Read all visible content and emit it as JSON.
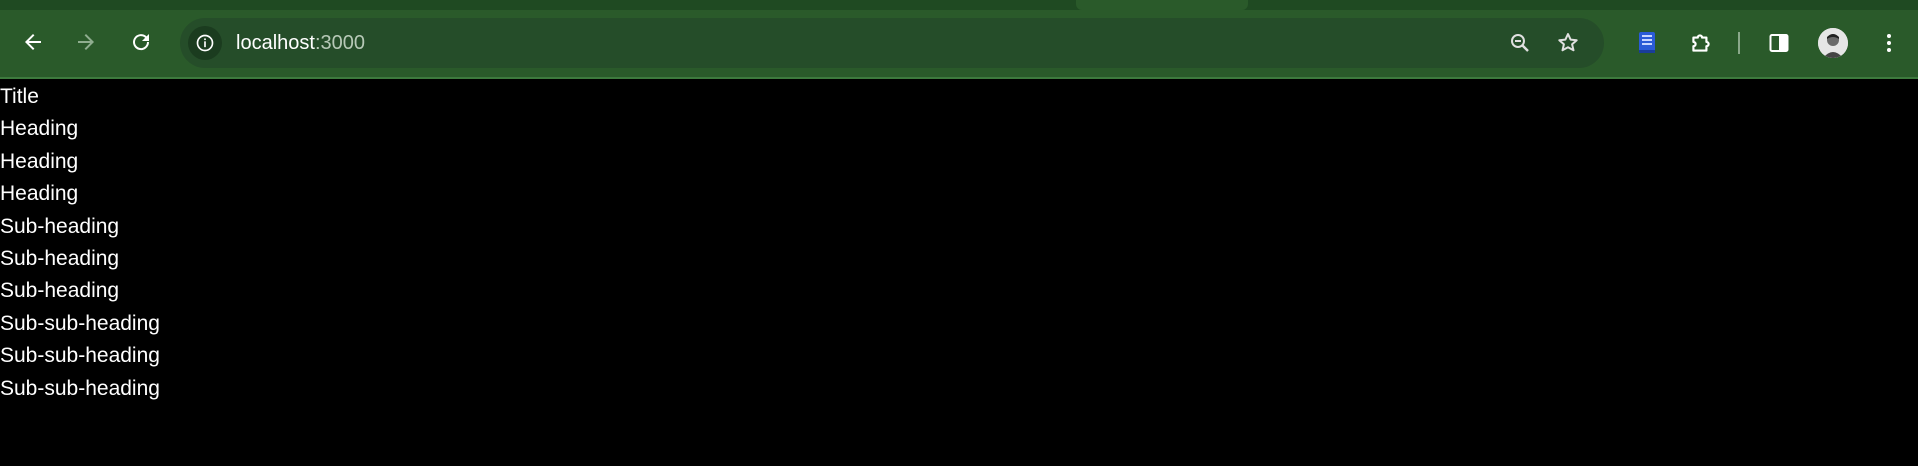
{
  "browser": {
    "url_host": "localhost",
    "url_port": ":3000",
    "icons": {
      "back": "arrow-left-icon",
      "forward": "arrow-right-icon",
      "reload": "reload-icon",
      "site_info": "info-icon",
      "zoom": "zoom-out-icon",
      "bookmark": "star-icon",
      "extension_book": "book-icon",
      "extensions": "puzzle-icon",
      "side_panel": "side-panel-icon",
      "profile": "avatar-icon",
      "menu": "kebab-menu-icon"
    },
    "colors": {
      "toolbar": "#2a5a2a",
      "omnibox": "#254d29",
      "page_background": "#000000",
      "page_text": "#ffffff"
    }
  },
  "page": {
    "lines": [
      "Title",
      "Heading",
      "Heading",
      "Heading",
      "Sub-heading",
      "Sub-heading",
      "Sub-heading",
      "Sub-sub-heading",
      "Sub-sub-heading",
      "Sub-sub-heading"
    ]
  }
}
